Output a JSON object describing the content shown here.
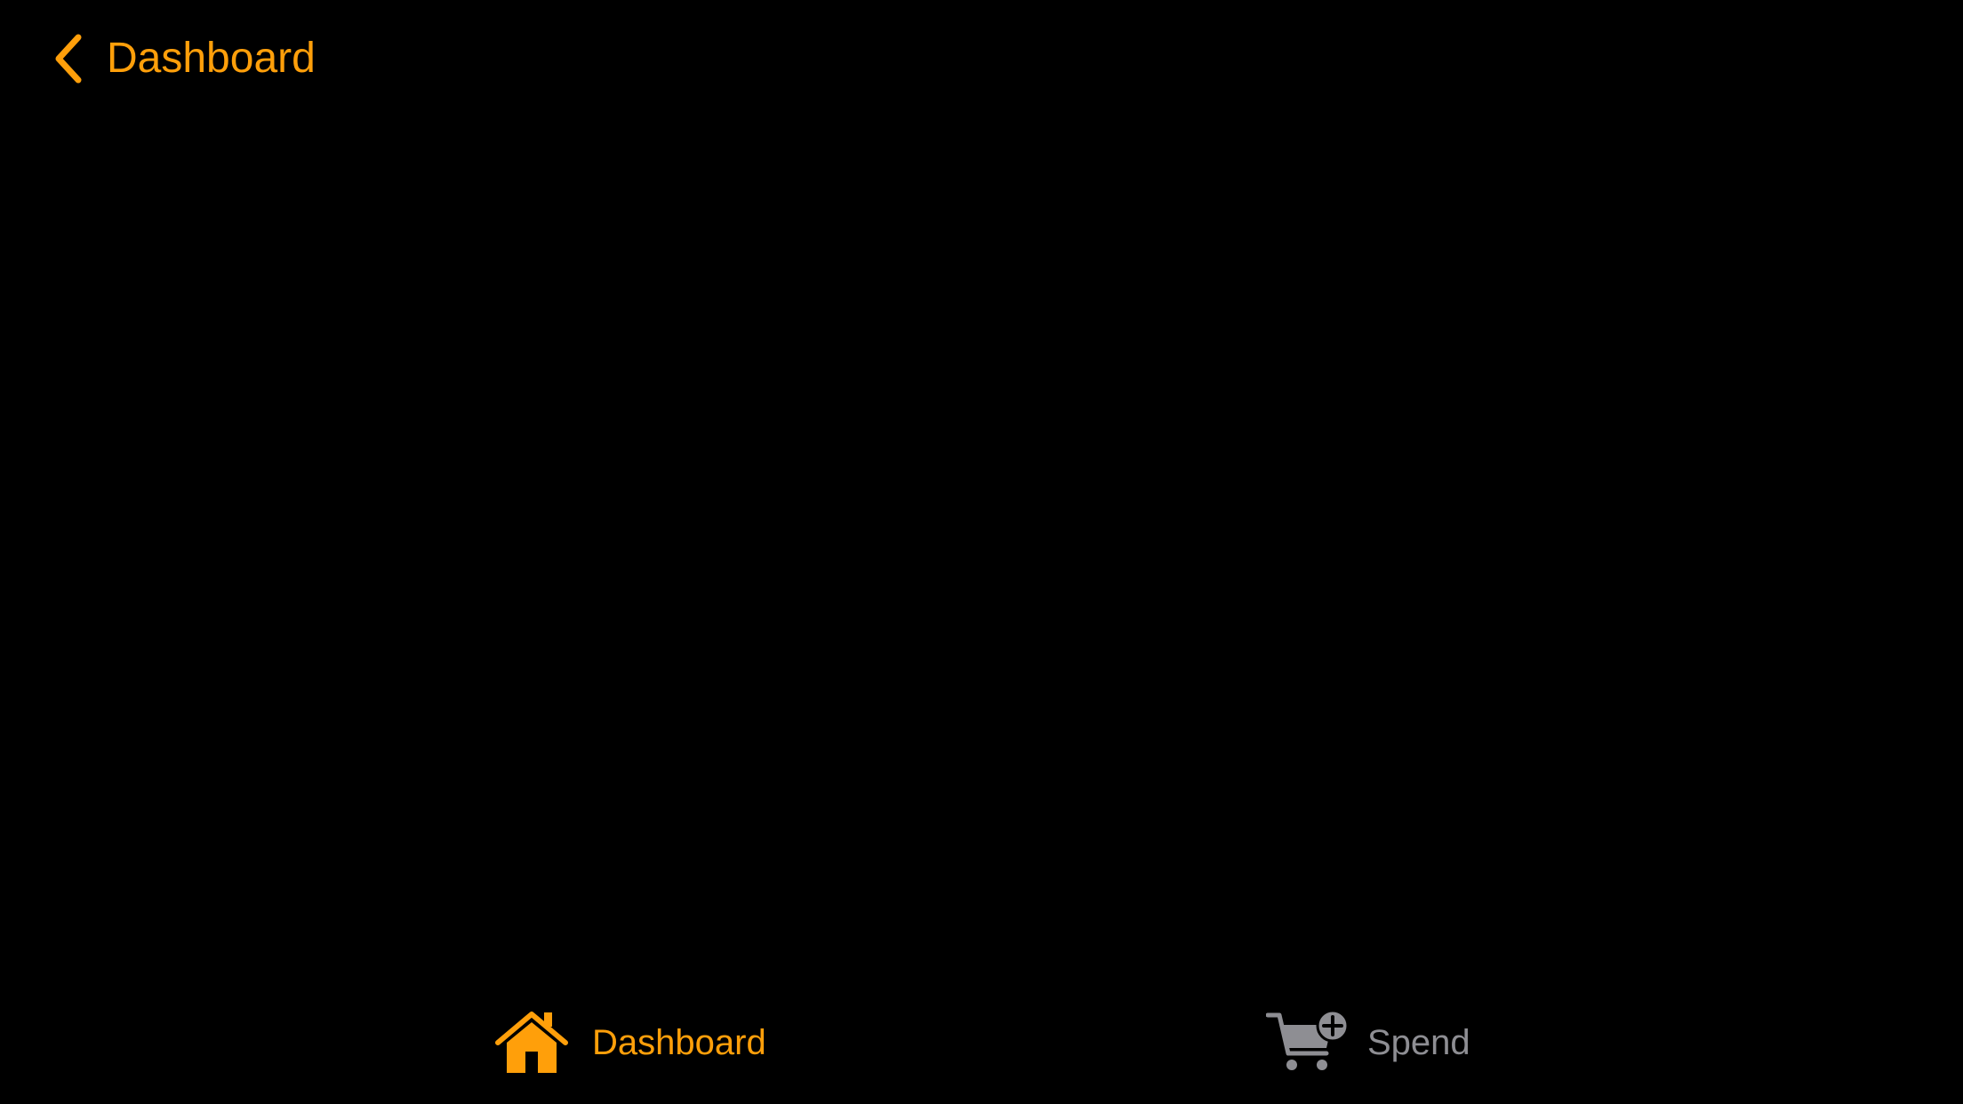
{
  "theme": {
    "background": "#000000",
    "accent": "#FF9F0A",
    "inactive": "#8E8E93"
  },
  "nav": {
    "back_icon": "chevron-left-icon",
    "back_label": "Dashboard"
  },
  "tab_bar": {
    "items": [
      {
        "label": "Dashboard",
        "icon": "house-icon",
        "selected": true
      },
      {
        "label": "Spend",
        "icon": "cart-plus-icon",
        "selected": false
      }
    ]
  }
}
